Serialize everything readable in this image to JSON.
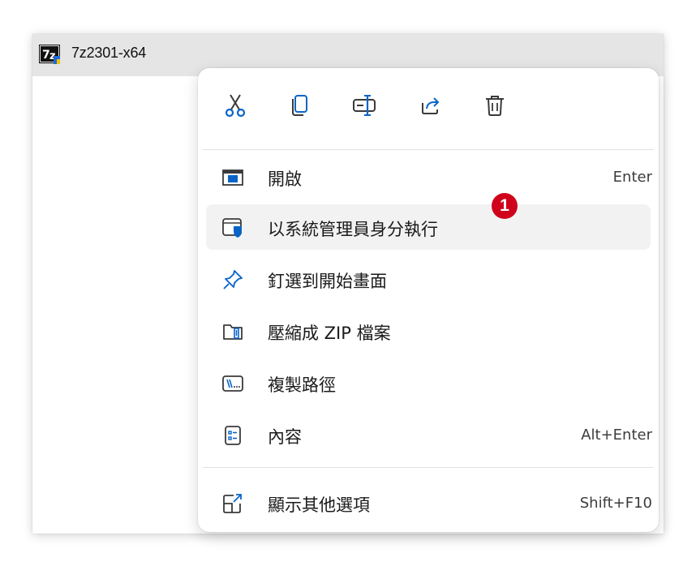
{
  "window": {
    "title": "7z2301-x64"
  },
  "colors": {
    "accent": "#0a64c8",
    "badge": "#d0021b",
    "icon_gray": "#3a3a3a",
    "highlight": "#f2f2f2"
  },
  "toolbar": {
    "buttons": [
      {
        "name": "cut",
        "icon": "scissors-icon"
      },
      {
        "name": "copy",
        "icon": "copy-icon"
      },
      {
        "name": "rename",
        "icon": "rename-icon"
      },
      {
        "name": "share",
        "icon": "share-icon"
      },
      {
        "name": "delete",
        "icon": "trash-icon"
      }
    ]
  },
  "menu": {
    "items": [
      {
        "label": "開啟",
        "shortcut": "Enter",
        "icon": "window-icon"
      },
      {
        "label": "以系統管理員身分執行",
        "shortcut": "",
        "icon": "admin-shield-icon",
        "highlighted": true
      },
      {
        "label": "釘選到開始畫面",
        "shortcut": "",
        "icon": "pin-icon"
      },
      {
        "label": "壓縮成 ZIP 檔案",
        "shortcut": "",
        "icon": "zip-folder-icon"
      },
      {
        "label": "複製路徑",
        "shortcut": "",
        "icon": "copy-path-icon"
      },
      {
        "label": "內容",
        "shortcut": "Alt+Enter",
        "icon": "properties-icon"
      },
      {
        "label": "顯示其他選項",
        "shortcut": "Shift+F10",
        "icon": "more-options-icon"
      }
    ]
  },
  "annotation": {
    "badge": "1"
  }
}
